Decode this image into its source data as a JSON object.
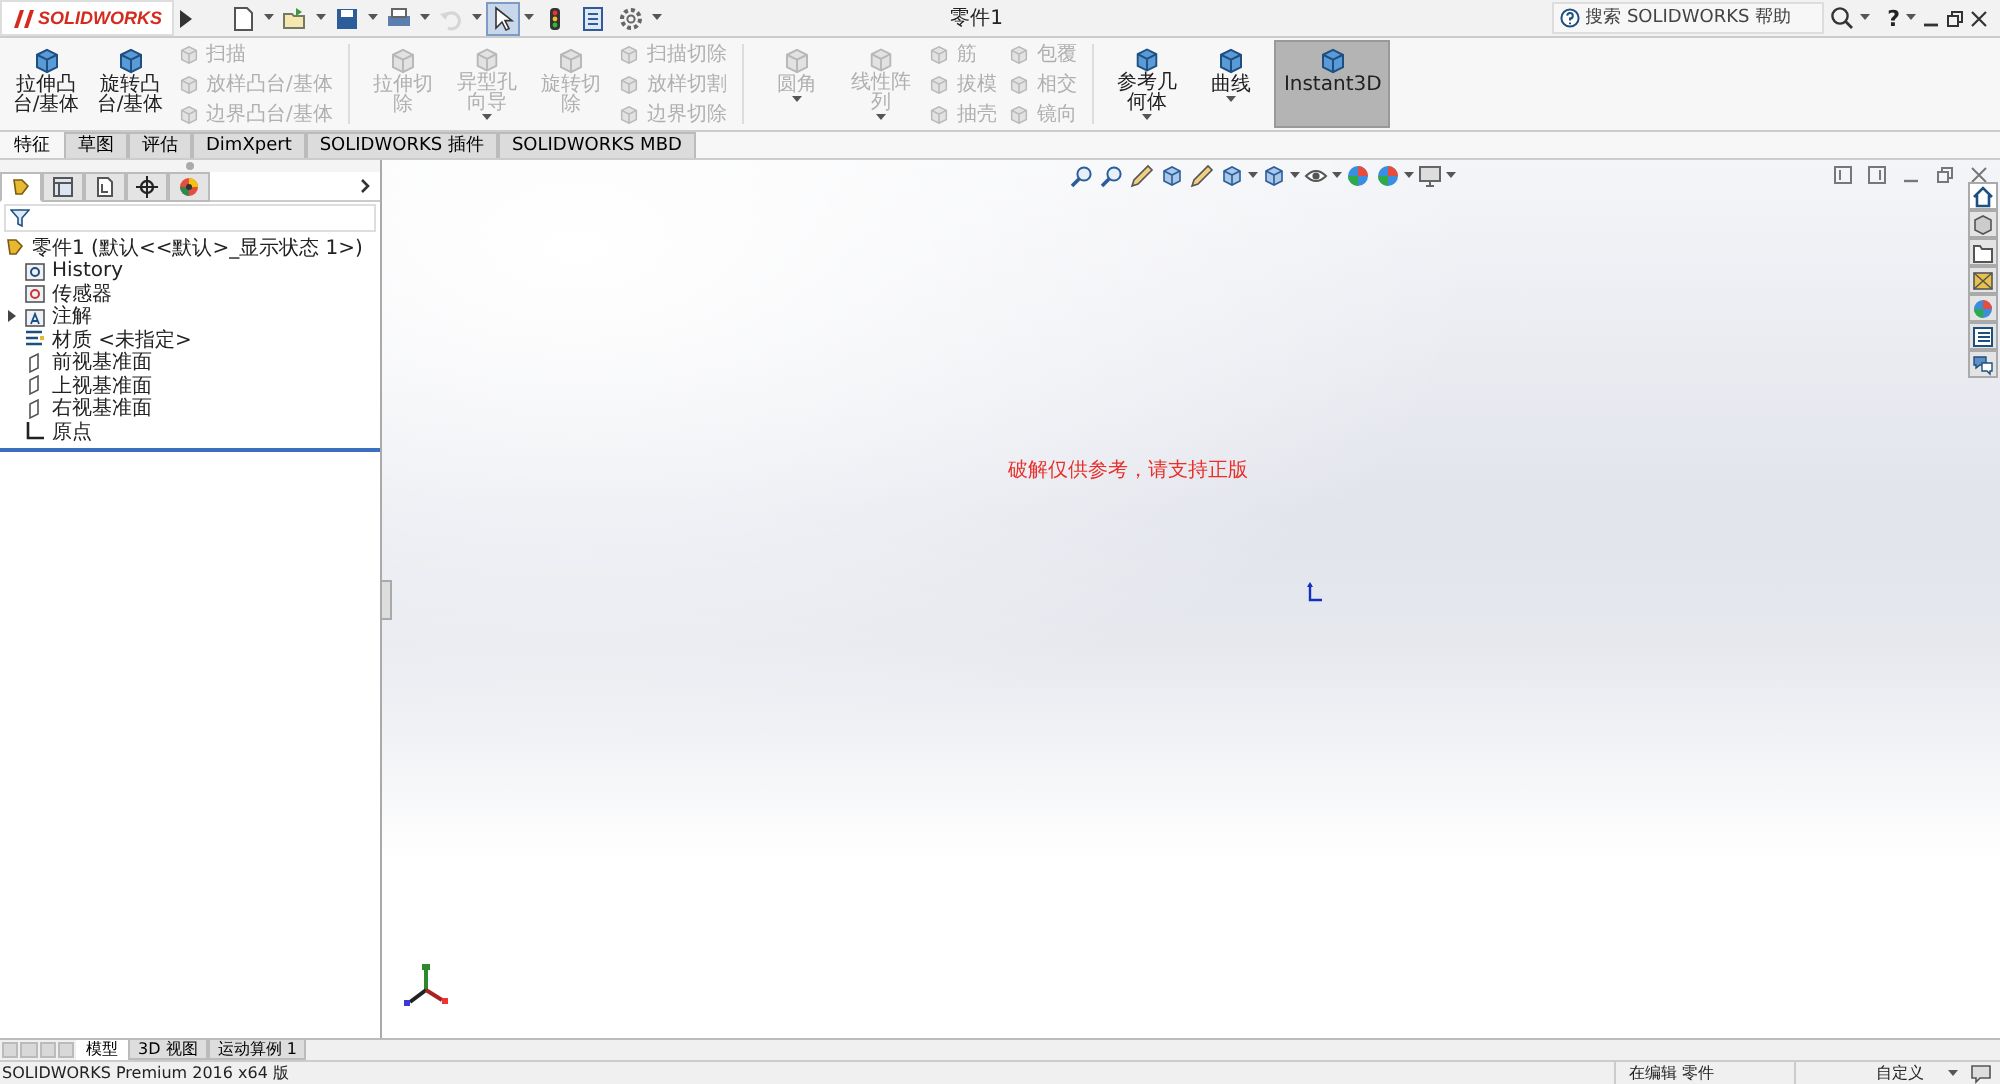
{
  "app": {
    "logo": "SOLIDWORKS",
    "title": "零件1"
  },
  "quick_access": [
    {
      "kind": "new",
      "dropdown": true,
      "selected": false,
      "disabled": false
    },
    {
      "kind": "open",
      "dropdown": true,
      "selected": false,
      "disabled": false
    },
    {
      "kind": "save",
      "dropdown": true,
      "selected": false,
      "disabled": false
    },
    {
      "kind": "print",
      "dropdown": true,
      "selected": false,
      "disabled": false
    },
    {
      "kind": "undo",
      "dropdown": true,
      "selected": false,
      "disabled": true
    },
    {
      "kind": "select",
      "dropdown": true,
      "selected": true,
      "disabled": false
    },
    {
      "kind": "rebuild",
      "dropdown": false,
      "selected": false,
      "disabled": false
    },
    {
      "kind": "properties",
      "dropdown": false,
      "selected": false,
      "disabled": false
    },
    {
      "kind": "options",
      "dropdown": true,
      "selected": false,
      "disabled": false
    }
  ],
  "search": {
    "placeholder": "搜索 SOLIDWORKS 帮助"
  },
  "help": "?",
  "ribbon": [
    {
      "kind": "large",
      "label": "拉伸凸台/基体",
      "disabled": false,
      "selected": false,
      "dropdown": false
    },
    {
      "kind": "large",
      "label": "旋转凸台/基体",
      "disabled": false,
      "selected": false,
      "dropdown": false
    },
    {
      "kind": "stack",
      "items": [
        {
          "label": "扫描",
          "disabled": true
        },
        {
          "label": "放样凸台/基体",
          "disabled": true
        },
        {
          "label": "边界凸台/基体",
          "disabled": true
        }
      ]
    },
    {
      "kind": "separator"
    },
    {
      "kind": "large",
      "label": "拉伸切除",
      "disabled": true,
      "selected": false,
      "dropdown": false
    },
    {
      "kind": "large",
      "label": "异型孔向导",
      "disabled": true,
      "selected": false,
      "dropdown": true
    },
    {
      "kind": "large",
      "label": "旋转切除",
      "disabled": true,
      "selected": false,
      "dropdown": false
    },
    {
      "kind": "stack",
      "items": [
        {
          "label": "扫描切除",
          "disabled": true
        },
        {
          "label": "放样切割",
          "disabled": true
        },
        {
          "label": "边界切除",
          "disabled": true
        }
      ]
    },
    {
      "kind": "separator"
    },
    {
      "kind": "large",
      "label": "圆角",
      "disabled": true,
      "selected": false,
      "dropdown": true
    },
    {
      "kind": "large",
      "label": "线性阵列",
      "disabled": true,
      "selected": false,
      "dropdown": true
    },
    {
      "kind": "stack",
      "items": [
        {
          "label": "筋",
          "disabled": true
        },
        {
          "label": "拔模",
          "disabled": true
        },
        {
          "label": "抽壳",
          "disabled": true
        }
      ]
    },
    {
      "kind": "stack",
      "items": [
        {
          "label": "包覆",
          "disabled": true
        },
        {
          "label": "相交",
          "disabled": true
        },
        {
          "label": "镜向",
          "disabled": true
        }
      ]
    },
    {
      "kind": "separator"
    },
    {
      "kind": "large",
      "label": "参考几何体",
      "disabled": false,
      "selected": false,
      "dropdown": true
    },
    {
      "kind": "large",
      "label": "曲线",
      "disabled": false,
      "selected": false,
      "dropdown": true
    },
    {
      "kind": "large",
      "label": "Instant3D",
      "disabled": false,
      "selected": true,
      "dropdown": false
    }
  ],
  "tabs": [
    {
      "label": "特征",
      "selected": true
    },
    {
      "label": "草图",
      "selected": false
    },
    {
      "label": "评估",
      "selected": false
    },
    {
      "label": "DimXpert",
      "selected": false
    },
    {
      "label": "SOLIDWORKS 插件",
      "selected": false
    },
    {
      "label": "SOLIDWORKS MBD",
      "selected": false
    }
  ],
  "manager_tabs": [
    {
      "kind": "feature",
      "selected": true
    },
    {
      "kind": "property",
      "selected": false
    },
    {
      "kind": "config",
      "selected": false
    },
    {
      "kind": "dimxpert",
      "selected": false
    },
    {
      "kind": "display",
      "selected": false
    }
  ],
  "tree": {
    "root": "零件1  (默认<<默认>_显示状态 1>)",
    "items": [
      {
        "kind": "history",
        "label": "History",
        "collapsed": false
      },
      {
        "kind": "sensor",
        "label": "传感器",
        "collapsed": false
      },
      {
        "kind": "annotation",
        "label": "注解",
        "collapsed": true
      },
      {
        "kind": "material",
        "label": "材质 <未指定>",
        "collapsed": false
      },
      {
        "kind": "plane",
        "label": "前视基准面",
        "collapsed": false
      },
      {
        "kind": "plane",
        "label": "上视基准面",
        "collapsed": false
      },
      {
        "kind": "plane",
        "label": "右视基准面",
        "collapsed": false
      },
      {
        "kind": "origin",
        "label": "原点",
        "collapsed": false
      }
    ]
  },
  "view_toolbar": [
    {
      "kind": "zoom-fit",
      "dropdown": false
    },
    {
      "kind": "zoom-area",
      "dropdown": false
    },
    {
      "kind": "previous",
      "dropdown": false
    },
    {
      "kind": "section",
      "dropdown": false
    },
    {
      "kind": "annotation",
      "dropdown": false
    },
    {
      "kind": "orientation",
      "dropdown": true
    },
    {
      "kind": "display-style",
      "dropdown": true
    },
    {
      "kind": "hide-show",
      "dropdown": true
    },
    {
      "kind": "appearance",
      "dropdown": false
    },
    {
      "kind": "scene",
      "dropdown": true
    },
    {
      "kind": "monitor",
      "dropdown": true
    }
  ],
  "task_pane": [
    {
      "kind": "home",
      "selected": true
    },
    {
      "kind": "parts",
      "selected": false
    },
    {
      "kind": "folder",
      "selected": false
    },
    {
      "kind": "palette",
      "selected": false
    },
    {
      "kind": "appearance",
      "selected": false
    },
    {
      "kind": "properties",
      "selected": false
    },
    {
      "kind": "forum",
      "selected": false
    }
  ],
  "graphics_notice": "破解仅供参考，请支持正版",
  "bottom_tabs": [
    {
      "label": "模型",
      "selected": true
    },
    {
      "label": "3D 视图",
      "selected": false
    },
    {
      "label": "运动算例 1",
      "selected": false
    }
  ],
  "status_bar": {
    "product": "SOLIDWORKS Premium 2016 x64 版",
    "mode": "在编辑 零件",
    "units": "自定义"
  }
}
